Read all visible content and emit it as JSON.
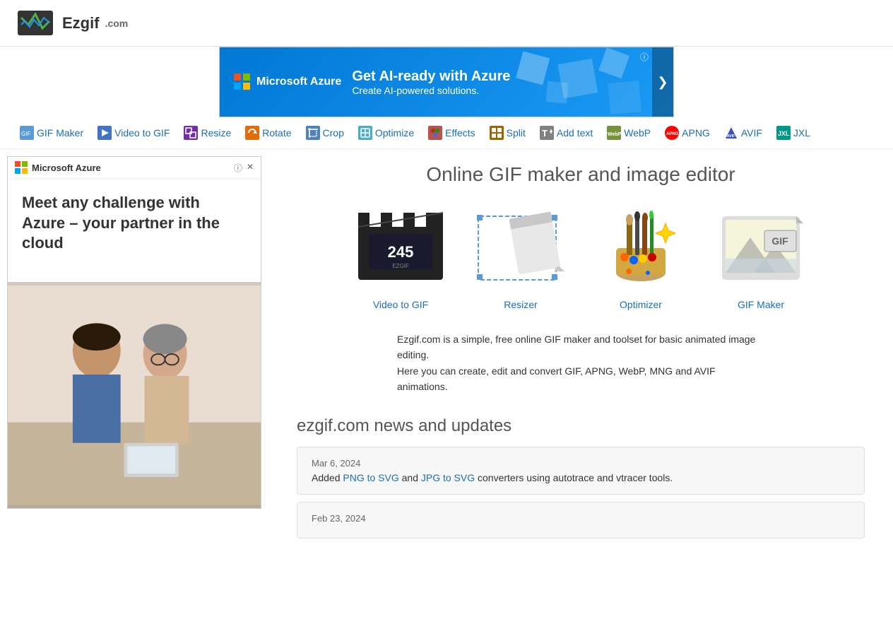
{
  "site": {
    "name": "Ezgif",
    "domain": ".com",
    "tagline": "Online GIF maker and image editor"
  },
  "ad_top": {
    "brand": "Microsoft Azure",
    "headline": "Get AI-ready with Azure",
    "subtext": "Create AI-powered solutions.",
    "info_icon": "ⓘ",
    "close_icon": "✕",
    "next_icon": "❯"
  },
  "nav": {
    "items": [
      {
        "id": "gif-maker",
        "label": "GIF Maker",
        "icon": "🖼"
      },
      {
        "id": "video-to-gif",
        "label": "Video to GIF",
        "icon": "🎬"
      },
      {
        "id": "resize",
        "label": "Resize",
        "icon": "⤢"
      },
      {
        "id": "rotate",
        "label": "Rotate",
        "icon": "↻"
      },
      {
        "id": "crop",
        "label": "Crop",
        "icon": "✂"
      },
      {
        "id": "optimize",
        "label": "Optimize",
        "icon": "⚙"
      },
      {
        "id": "effects",
        "label": "Effects",
        "icon": "✨"
      },
      {
        "id": "split",
        "label": "Split",
        "icon": "⊞"
      },
      {
        "id": "add-text",
        "label": "Add text",
        "icon": "T"
      },
      {
        "id": "webp",
        "label": "WebP",
        "icon": "🌐"
      },
      {
        "id": "apng",
        "label": "APNG",
        "icon": "🔴"
      },
      {
        "id": "avif",
        "label": "AVIF",
        "icon": "💠"
      },
      {
        "id": "jxl",
        "label": "JXL",
        "icon": "⚡"
      }
    ]
  },
  "sidebar_ad": {
    "brand": "Microsoft Azure",
    "info_icon": "ⓘ",
    "close_icon": "✕",
    "headline": "Meet any challenge with Azure – your partner in the cloud"
  },
  "features": [
    {
      "id": "video-to-gif",
      "label": "Video to GIF"
    },
    {
      "id": "resizer",
      "label": "Resizer"
    },
    {
      "id": "optimizer",
      "label": "Optimizer"
    },
    {
      "id": "gif-maker",
      "label": "GIF Maker"
    }
  ],
  "description": {
    "line1": "Ezgif.com is a simple, free online GIF maker and toolset for basic animated image editing.",
    "line2": "Here you can create, edit and convert GIF, APNG, WebP, MNG and AVIF animations."
  },
  "news": {
    "title": "ezgif.com news and updates",
    "items": [
      {
        "date": "Mar 6, 2024",
        "text_before": "Added ",
        "link1_text": "PNG to SVG",
        "link1_url": "#",
        "text_middle": " and ",
        "link2_text": "JPG to SVG",
        "link2_url": "#",
        "text_after": " converters using autotrace and vtracer tools."
      },
      {
        "date": "Feb 23, 2024",
        "text": ""
      }
    ]
  }
}
